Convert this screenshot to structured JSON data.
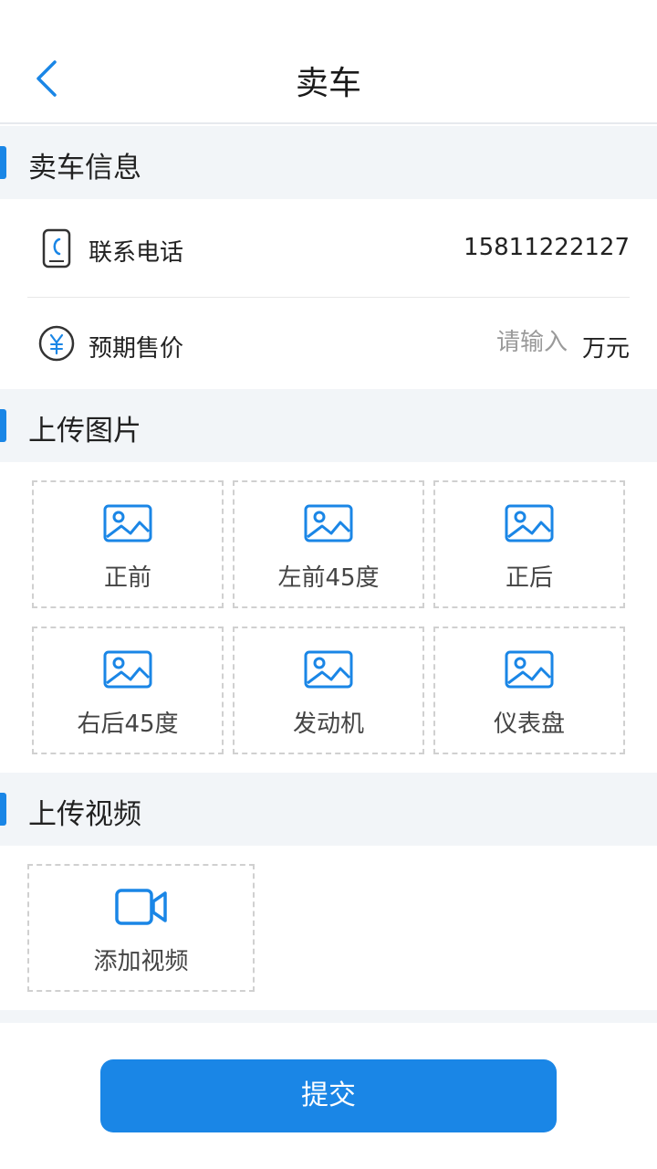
{
  "header": {
    "title": "卖车"
  },
  "sell_info": {
    "heading": "卖车信息",
    "phone_label": "联系电话",
    "phone_value": "15811222127",
    "price_label": "预期售价",
    "price_placeholder": "请输入",
    "price_unit": "万元"
  },
  "upload_images": {
    "heading": "上传图片",
    "tiles": [
      "正前",
      "左前45度",
      "正后",
      "右后45度",
      "发动机",
      "仪表盘"
    ]
  },
  "upload_video": {
    "heading": "上传视频",
    "add_label": "添加视频"
  },
  "submit_label": "提交",
  "colors": {
    "accent": "#1a86e6",
    "section_bg": "#f2f5f8"
  }
}
